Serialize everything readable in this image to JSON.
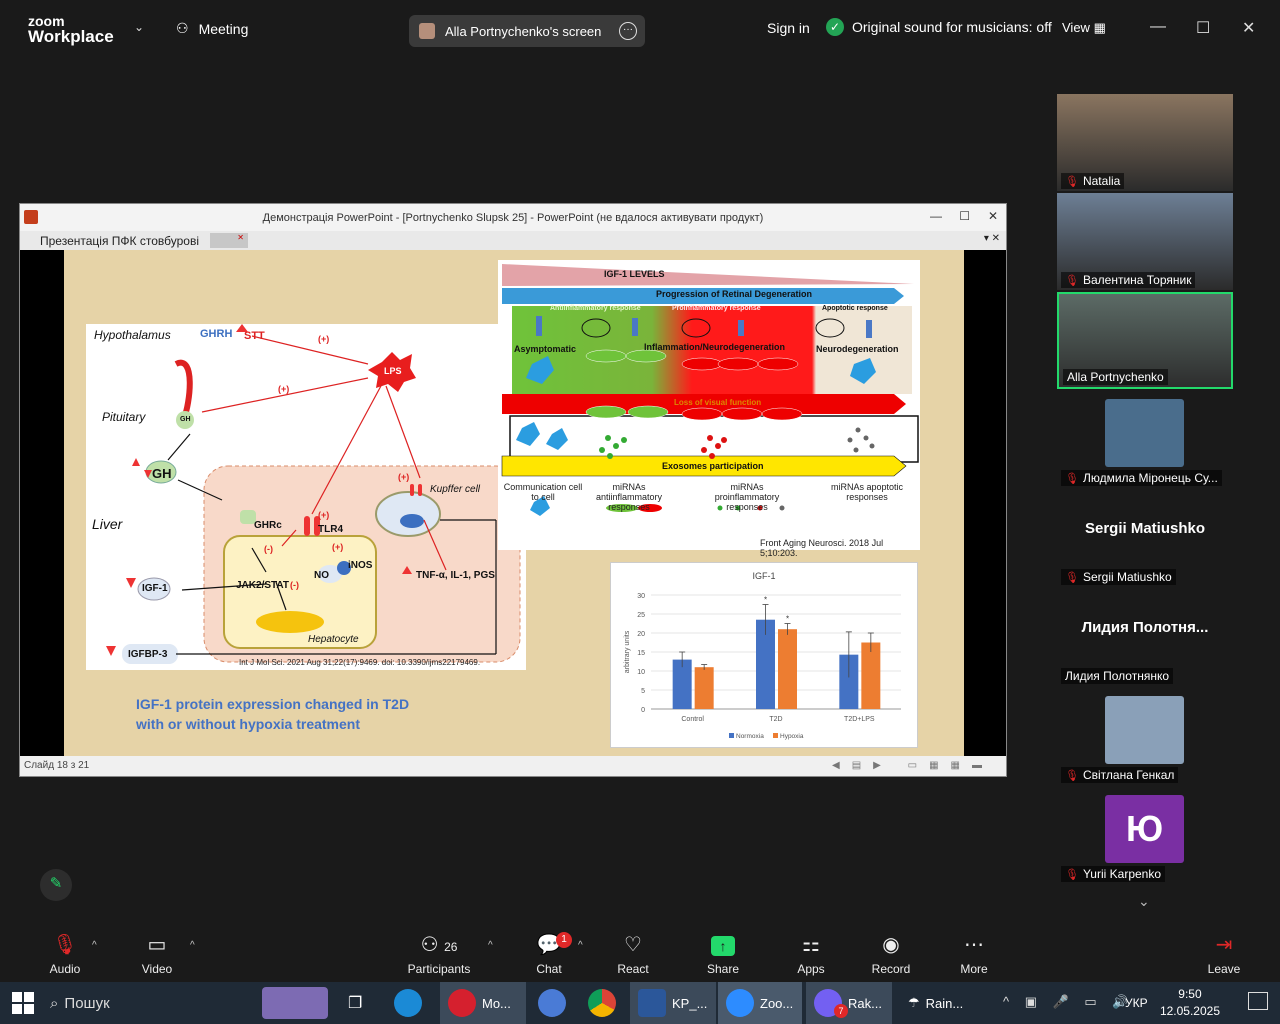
{
  "topbar": {
    "logo_line1": "zoom",
    "logo_line2": "Workplace",
    "meeting_label": "Meeting",
    "share_label": "Alla Portnychenko's screen",
    "signin": "Sign in",
    "sound_label": "Original sound for musicians: off",
    "view_label": "View"
  },
  "ppt": {
    "window_title": "Демонстрація PowerPoint - [Portnychenko Slupsk 25] - PowerPoint (не вдалося активувати продукт)",
    "tab_label": "Презентація ПФК стовбурові",
    "status": "Слайд 18 з 21"
  },
  "slide": {
    "liver_labels": {
      "hypothalamus": "Hypothalamus",
      "ghrh": "GHRH",
      "stt": "STT",
      "lps": "LPS",
      "pituitary": "Pituitary",
      "gh": "GH",
      "liver": "Liver",
      "kupffer": "Kupffer cell",
      "ghrc": "GHRc",
      "tlr4": "TLR4",
      "jak": "JAK2/STAT",
      "no": "NO",
      "inos": "iNOS",
      "tnf": "TNF-α, IL-1, PGS",
      "igf1": "IGF-1",
      "hepatocyte": "Hepatocyte",
      "igfbp": "IGFBP-3",
      "plus": "(+)",
      "minus": "(-)"
    },
    "liver_ref": "Int J Mol Sci. 2021 Aug 31;22(17):9469. doi: 10.3390/ijms22179469.",
    "caption_line1": "IGF-1 protein expression changed in T2D",
    "caption_line2": "with or without hypoxia treatment",
    "retina": {
      "igf_levels": "IGF-1 LEVELS",
      "progression": "Progression of Retinal Degeneration",
      "anti": "Antiinflammatory response",
      "pro": "Proinflammatory response",
      "apop": "Apoptotic response",
      "asymptomatic": "Asymptomatic",
      "inflammation": "Inflammation/Neurodegeneration",
      "neurodeg": "Neurodegeneration",
      "loss": "Loss of visual function",
      "exosomes": "Exosomes participation",
      "col1": "Communication cell to cell",
      "col2": "miRNAs antiinflammatory responses",
      "col3": "miRNAs proinflammatory responses",
      "col4": "miRNAs apoptotic responses",
      "ref": "Front Aging Neurosci. 2018 Jul 5;10:203."
    }
  },
  "chart_data": {
    "type": "bar",
    "title": "IGF-1",
    "ylabel": "arbitrary units",
    "xlabel": "",
    "ylim": [
      0,
      30
    ],
    "yticks": [
      0,
      5,
      10,
      15,
      20,
      25,
      30
    ],
    "categories": [
      "Control",
      "T2D",
      "T2D+LPS"
    ],
    "series": [
      {
        "name": "Normoxia",
        "values": [
          13,
          23.5,
          14.3
        ],
        "errors": [
          2,
          4,
          6
        ],
        "color": "#4472c4"
      },
      {
        "name": "Hypoxia",
        "values": [
          11,
          21,
          17.5
        ],
        "errors": [
          0.7,
          1.5,
          2.5
        ],
        "color": "#ed7d31"
      }
    ],
    "significance": [
      "",
      "*",
      ""
    ],
    "significance_hypoxia": [
      "",
      "*",
      ""
    ],
    "legend": "bottom"
  },
  "participants": [
    {
      "name": "Natalia",
      "muted": true
    },
    {
      "name": "Валентина Торяник",
      "muted": true
    },
    {
      "name": "Alla Portnychenko",
      "muted": false,
      "active": true
    },
    {
      "name": "Людмила Міронець Су...",
      "muted": true
    },
    {
      "name": "Sergii Matiushko",
      "muted": true,
      "big": "Sergii Matiushko"
    },
    {
      "name": "Лидия Полотнянко",
      "muted": false,
      "big": "Лидия Полотня..."
    },
    {
      "name": "Світлана Генкал",
      "muted": true
    },
    {
      "name": "Yurii Karpenko",
      "muted": true,
      "initial": "Ю"
    }
  ],
  "toolbar": {
    "audio": "Audio",
    "video": "Video",
    "participants": "Participants",
    "participants_count": "26",
    "chat": "Chat",
    "chat_badge": "1",
    "react": "React",
    "share": "Share",
    "apps": "Apps",
    "record": "Record",
    "more": "More",
    "leave": "Leave"
  },
  "taskbar": {
    "search": "Пошук",
    "opera": "Mo...",
    "word": "KP_...",
    "zoom": "Zoo...",
    "viber": "Rak...",
    "viber_badge": "7",
    "weather": "Rain...",
    "lang": "УКР",
    "time": "9:50",
    "date": "12.05.2025"
  },
  "colors": {
    "accent_green": "#23d96b",
    "mute_red": "#e02828",
    "chart_blue": "#4472c4",
    "chart_orange": "#ed7d31"
  }
}
